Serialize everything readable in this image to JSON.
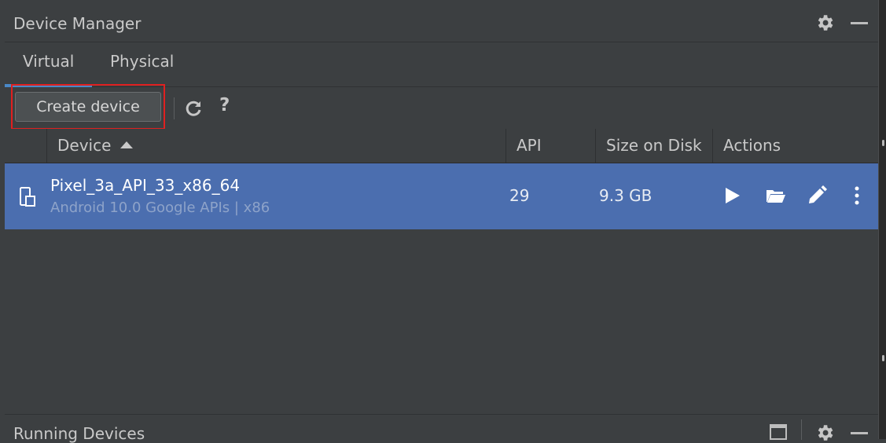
{
  "panel": {
    "title": "Device Manager",
    "settings_icon": "gear-icon",
    "minimize_icon": "minimize-icon"
  },
  "tabs": [
    {
      "label": "Virtual",
      "selected": true
    },
    {
      "label": "Physical",
      "selected": false
    }
  ],
  "toolbar": {
    "create_label": "Create device",
    "refresh_icon": "refresh-icon",
    "help_label": "?"
  },
  "table": {
    "columns": [
      "Device",
      "API",
      "Size on Disk",
      "Actions"
    ],
    "sort": {
      "column": "Device",
      "direction": "ascending"
    },
    "rows": [
      {
        "name": "Pixel_3a_API_33_x86_64",
        "subtitle": "Android 10.0 Google APIs | x86",
        "api": "29",
        "size": "9.3 GB",
        "selected": true,
        "actions": [
          "play-icon",
          "folder-icon",
          "pencil-icon",
          "more-vert-icon"
        ]
      }
    ]
  },
  "running": {
    "title": "Running Devices"
  },
  "colors": {
    "panel_bg": "#3c3f41",
    "selection": "#4b6eaf",
    "tab_accent": "#4a88c7",
    "highlight": "#e02020"
  }
}
